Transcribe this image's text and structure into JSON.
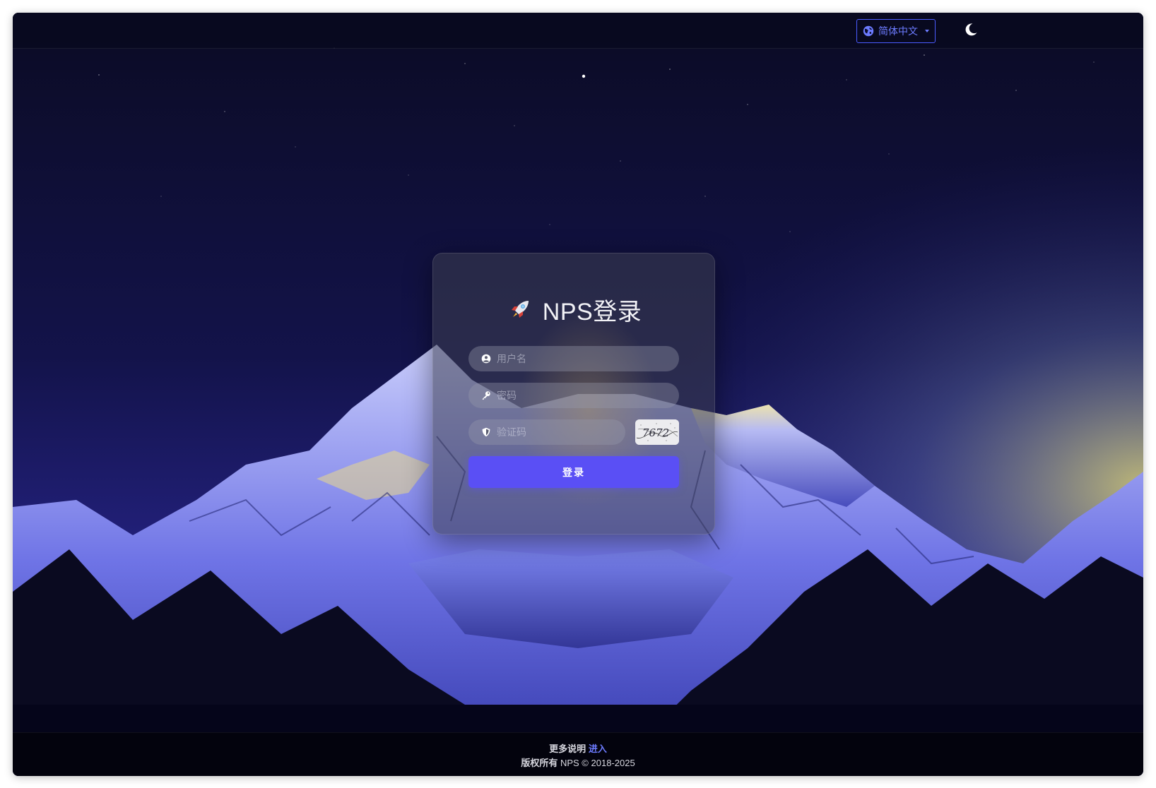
{
  "header": {
    "language_label": "简体中文",
    "globe_icon": "globe-icon",
    "theme_icon": "moon-icon",
    "accent": "#6c7bff"
  },
  "login": {
    "title": "NPS登录",
    "title_icon": "rocket-icon",
    "username_placeholder": "用户名",
    "password_placeholder": "密码",
    "captcha_placeholder": "验证码",
    "captcha_text": "7672",
    "submit_label": "登录",
    "button_color": "#5a4ff5"
  },
  "footer": {
    "more_info_label": "更多说明",
    "more_info_link": "进入",
    "copyright_prefix": "版权所有",
    "copyright_text": "NPS © 2018-2025"
  }
}
